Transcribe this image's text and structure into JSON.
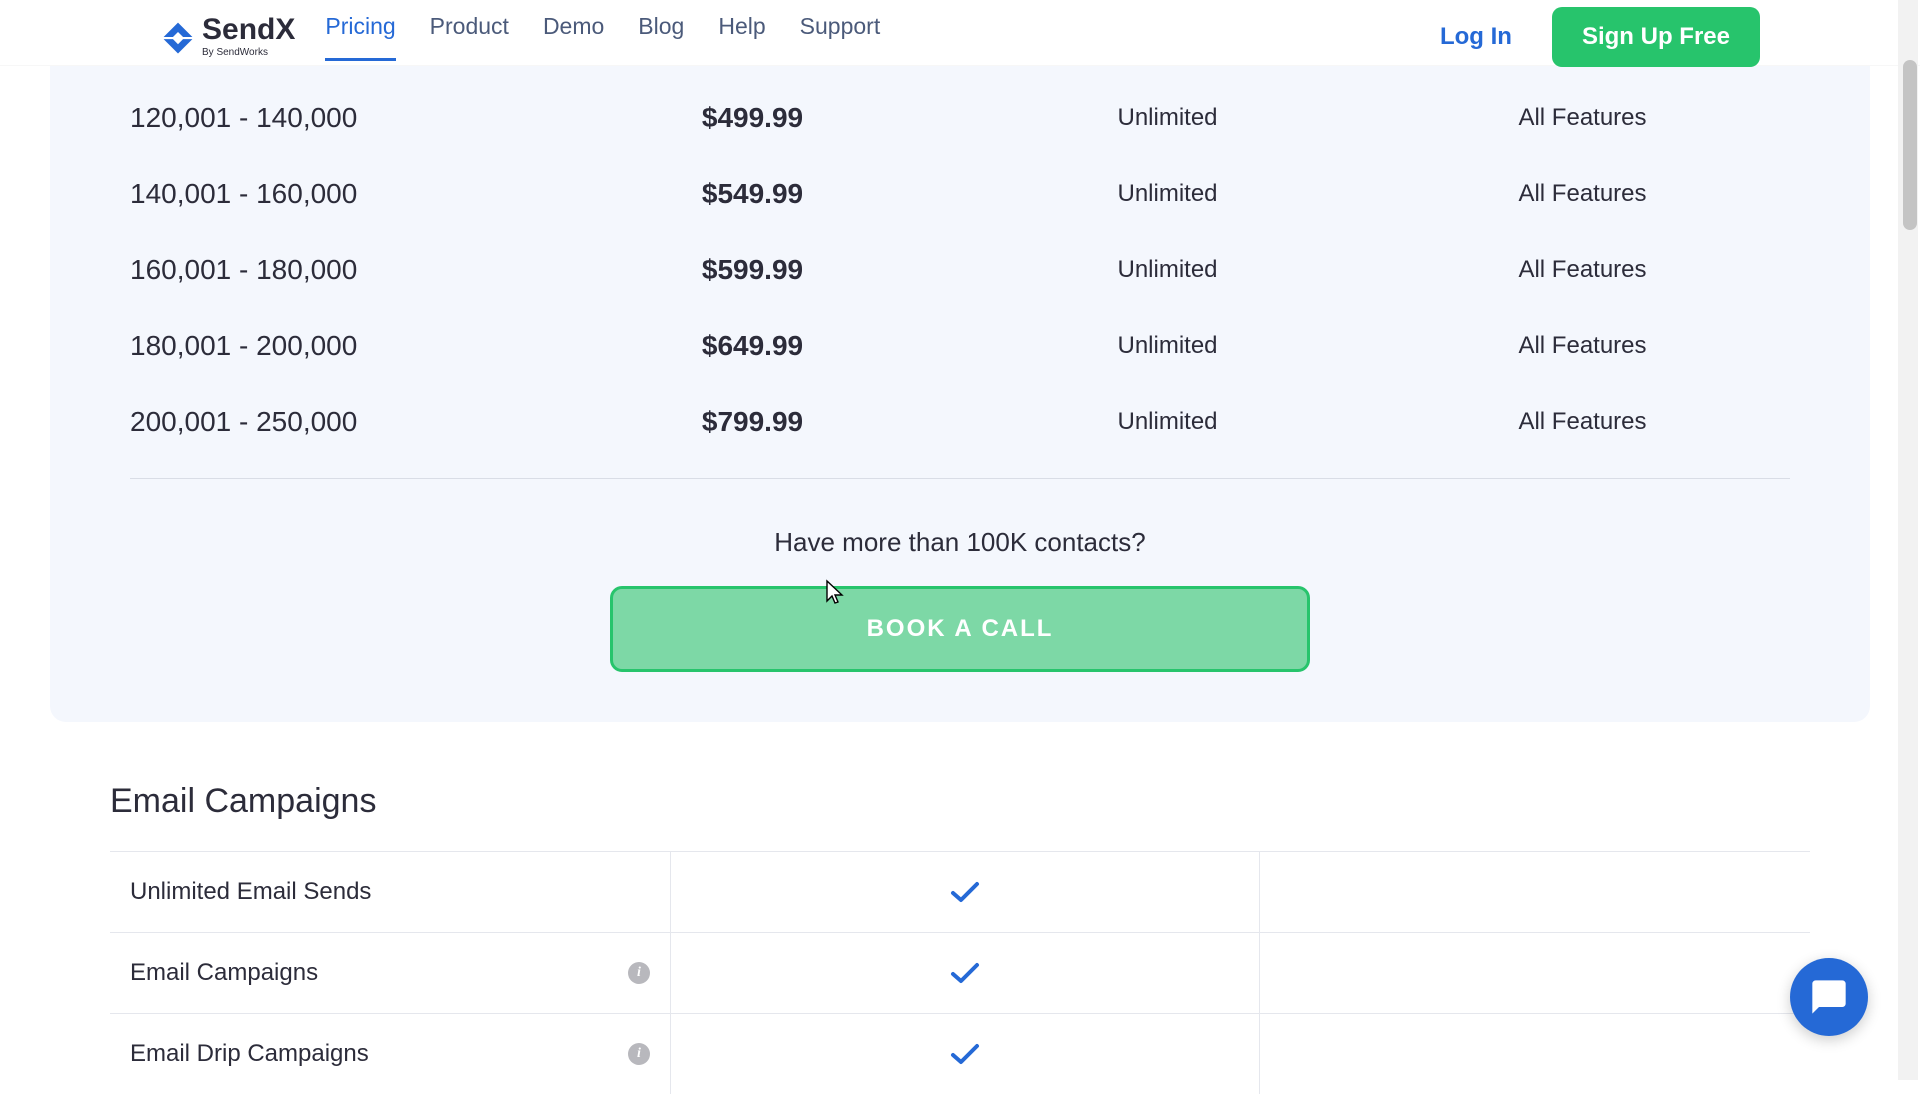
{
  "header": {
    "brand": "SendX",
    "brand_sub": "By SendWorks",
    "nav": [
      "Pricing",
      "Product",
      "Demo",
      "Blog",
      "Help",
      "Support"
    ],
    "active_nav": "Pricing",
    "login": "Log In",
    "signup": "Sign Up Free"
  },
  "pricing": {
    "rows": [
      {
        "tier": "120,001 - 140,000",
        "price": "$499.99",
        "sends": "Unlimited",
        "feat": "All Features"
      },
      {
        "tier": "140,001 - 160,000",
        "price": "$549.99",
        "sends": "Unlimited",
        "feat": "All Features"
      },
      {
        "tier": "160,001 - 180,000",
        "price": "$599.99",
        "sends": "Unlimited",
        "feat": "All Features"
      },
      {
        "tier": "180,001 - 200,000",
        "price": "$649.99",
        "sends": "Unlimited",
        "feat": "All Features"
      },
      {
        "tier": "200,001 - 250,000",
        "price": "$799.99",
        "sends": "Unlimited",
        "feat": "All Features"
      }
    ],
    "cta_text": "Have more than 100K contacts?",
    "cta_button": "BOOK A CALL"
  },
  "features_section": {
    "title": "Email Campaigns",
    "rows": [
      {
        "name": "Unlimited Email Sends",
        "info": false,
        "check": true
      },
      {
        "name": "Email Campaigns",
        "info": true,
        "check": true
      },
      {
        "name": "Email Drip Campaigns",
        "info": true,
        "check": true
      }
    ]
  }
}
